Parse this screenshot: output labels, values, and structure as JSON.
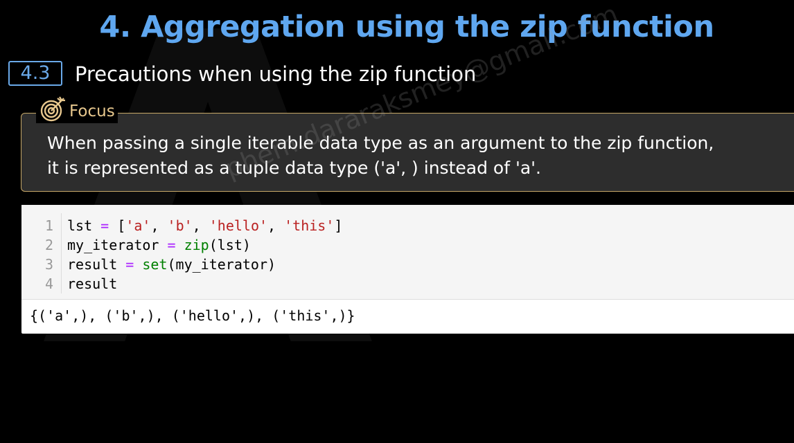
{
  "slide": {
    "title": "4. Aggregation using the zip function",
    "section_number": "4.3",
    "section_title": "Precautions when using the zip function"
  },
  "focus": {
    "label": "Focus",
    "icon": "target-icon",
    "text_line1": "When passing a single iterable data type as an argument to the zip function,",
    "text_line2": "it is represented as a tuple data type ('a', ) instead of 'a'."
  },
  "code": {
    "line_numbers": [
      "1",
      "2",
      "3",
      "4"
    ],
    "line1": {
      "var": "lst",
      "op": "=",
      "open": "[",
      "s1": "'a'",
      "s2": "'b'",
      "s3": "'hello'",
      "s4": "'this'",
      "close": "]",
      "comma": ","
    },
    "line2": {
      "var": "my_iterator",
      "op": "=",
      "fn": "zip",
      "args": "(lst)"
    },
    "line3": {
      "var": "result",
      "op": "=",
      "fn": "set",
      "args": "(my_iterator)"
    },
    "line4": {
      "var": "result"
    },
    "output": "{('a',), ('b',), ('hello',), ('this',)}"
  },
  "watermark": "phem.dararaksmey@gmail.com",
  "colors": {
    "title": "#5fa7f0",
    "badge": "#6aa9e9",
    "focus_border": "#c8a968",
    "focus_label": "#e8c88e",
    "focus_bg": "#2d2d2d",
    "code_bg": "#f5f5f5",
    "string": "#ba2121",
    "builtin": "#008000",
    "operator": "#aa22ff"
  }
}
